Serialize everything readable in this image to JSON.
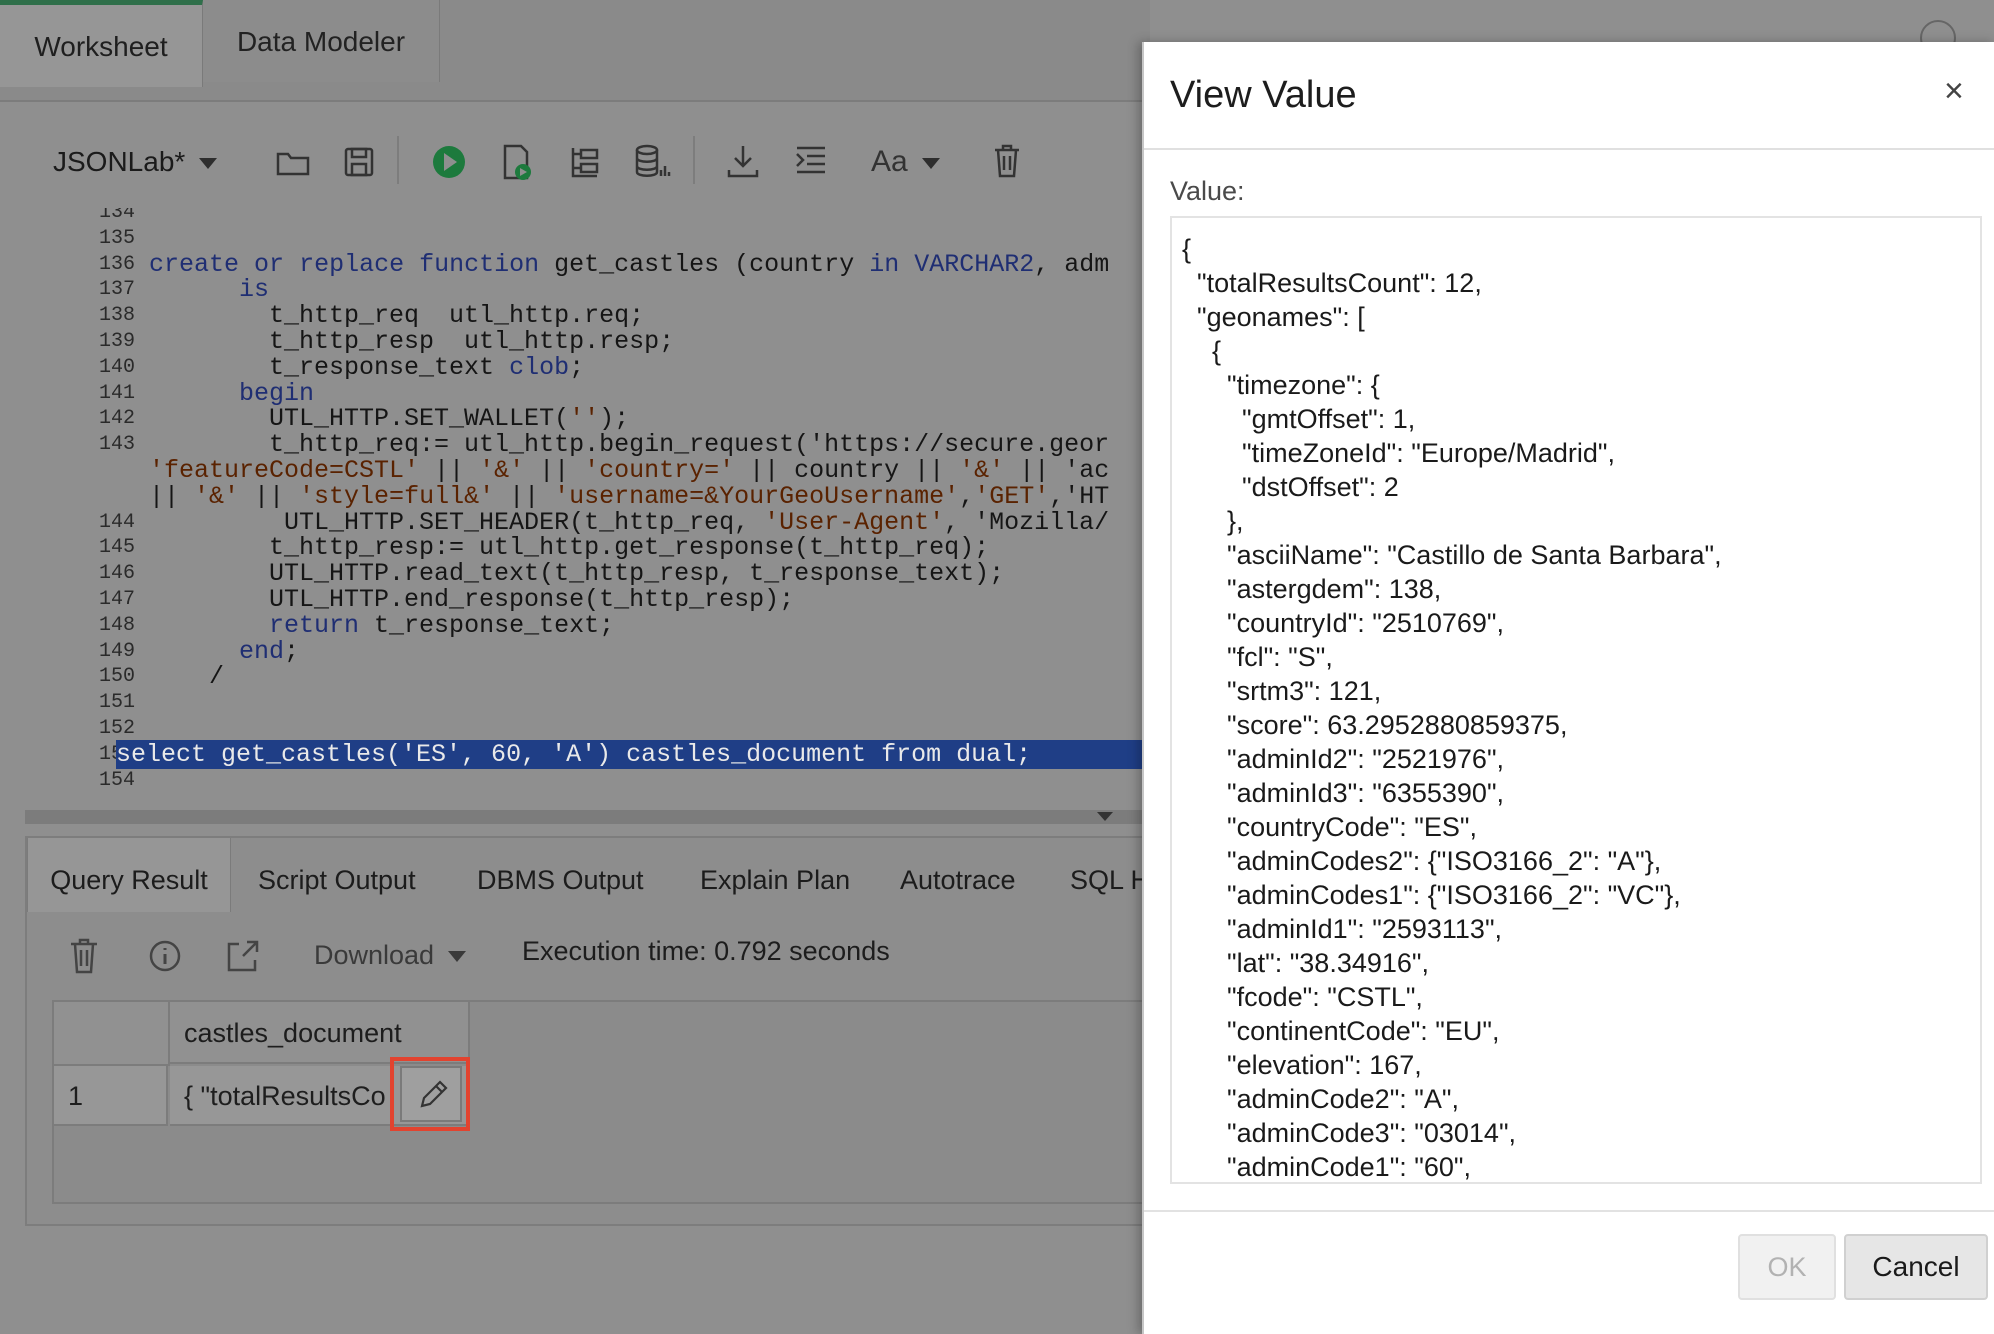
{
  "top_tabs": [
    "Worksheet",
    "Data Modeler"
  ],
  "toolbar": {
    "worksheet_name": "JSONLab*",
    "font_label": "Aa"
  },
  "editor": {
    "line_numbers": [
      "134",
      "135",
      "136",
      "137",
      "138",
      "139",
      "140",
      "141",
      "142",
      "143",
      "",
      "",
      "144",
      "145",
      "146",
      "147",
      "148",
      "149",
      "150",
      "151",
      "152",
      "153",
      "154"
    ],
    "lines": [
      "",
      "",
      "create or replace function get_castles (country in VARCHAR2, adm",
      "      is",
      "        t_http_req  utl_http.req;",
      "        t_http_resp  utl_http.resp;",
      "        t_response_text clob;",
      "      begin",
      "        UTL_HTTP.SET_WALLET('');",
      "        t_http_req:= utl_http.begin_request('https://secure.geor",
      "'featureCode=CSTL' || '&' || 'country=' || country || '&' || 'ac",
      "|| '&' || 'style=full&' || 'username=&YourGeoUsername','GET','HT",
      "         UTL_HTTP.SET_HEADER(t_http_req, 'User-Agent', 'Mozilla/",
      "        t_http_resp:= utl_http.get_response(t_http_req);",
      "        UTL_HTTP.read_text(t_http_resp, t_response_text);",
      "        UTL_HTTP.end_response(t_http_resp);",
      "        return t_response_text;",
      "      end;",
      "    /",
      "",
      "",
      "select get_castles('ES', 60, 'A') castles_document from dual;",
      ""
    ]
  },
  "result_tabs": [
    "Query Result",
    "Script Output",
    "DBMS Output",
    "Explain Plan",
    "Autotrace",
    "SQL H"
  ],
  "result_toolbar": {
    "download_label": "Download",
    "execution_time": "Execution time: 0.792 seconds"
  },
  "grid": {
    "column": "castles_document",
    "rows": [
      {
        "num": "1",
        "value": "{ \"totalResultsCo"
      }
    ]
  },
  "modal": {
    "title": "View Value",
    "close": "×",
    "value_label": "Value:",
    "json_lines": [
      "{",
      "  \"totalResultsCount\": 12,",
      "  \"geonames\": [",
      "    {",
      "      \"timezone\": {",
      "        \"gmtOffset\": 1,",
      "        \"timeZoneId\": \"Europe/Madrid\",",
      "        \"dstOffset\": 2",
      "      },",
      "      \"asciiName\": \"Castillo de Santa Barbara\",",
      "      \"astergdem\": 138,",
      "      \"countryId\": \"2510769\",",
      "      \"fcl\": \"S\",",
      "      \"srtm3\": 121,",
      "      \"score\": 63.2952880859375,",
      "      \"adminId2\": \"2521976\",",
      "      \"adminId3\": \"6355390\",",
      "      \"countryCode\": \"ES\",",
      "      \"adminCodes2\": {\"ISO3166_2\": \"A\"},",
      "      \"adminCodes1\": {\"ISO3166_2\": \"VC\"},",
      "      \"adminId1\": \"2593113\",",
      "      \"lat\": \"38.34916\",",
      "      \"fcode\": \"CSTL\",",
      "      \"continentCode\": \"EU\",",
      "      \"elevation\": 167,",
      "      \"adminCode2\": \"A\",",
      "      \"adminCode3\": \"03014\",",
      "      \"adminCode1\": \"60\","
    ],
    "ok_label": "OK",
    "cancel_label": "Cancel"
  }
}
